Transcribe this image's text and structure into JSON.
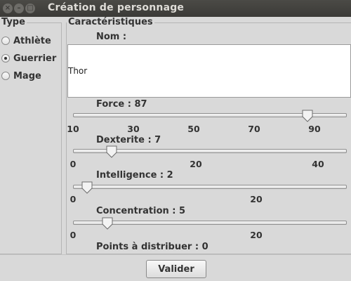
{
  "window": {
    "title": "Création de personnage"
  },
  "type_panel": {
    "legend": "Type",
    "options": [
      {
        "label": "Athlète",
        "checked": false
      },
      {
        "label": "Guerrier",
        "checked": true
      },
      {
        "label": "Mage",
        "checked": false
      }
    ]
  },
  "char_panel": {
    "legend": "Caractéristiques",
    "name_label": "Nom :",
    "name_value": "Thor",
    "force": {
      "label": "Force : 87",
      "value": 87,
      "min": 10,
      "max": 100,
      "ticks": [
        "10",
        "30",
        "50",
        "70",
        "90"
      ]
    },
    "dexterite": {
      "label": "Dexterite : 7",
      "value": 7,
      "min": 0,
      "max": 50,
      "ticks": [
        "0",
        "20",
        "40"
      ]
    },
    "intelligence": {
      "label": "Intelligence : 2",
      "value": 2,
      "min": 0,
      "max": 40,
      "ticks": [
        "0",
        "20"
      ]
    },
    "concentration": {
      "label": "Concentration : 5",
      "value": 5,
      "min": 0,
      "max": 40,
      "ticks": [
        "0",
        "20"
      ]
    },
    "points": "Points à distribuer : 0"
  },
  "buttons": {
    "valider": "Valider"
  }
}
